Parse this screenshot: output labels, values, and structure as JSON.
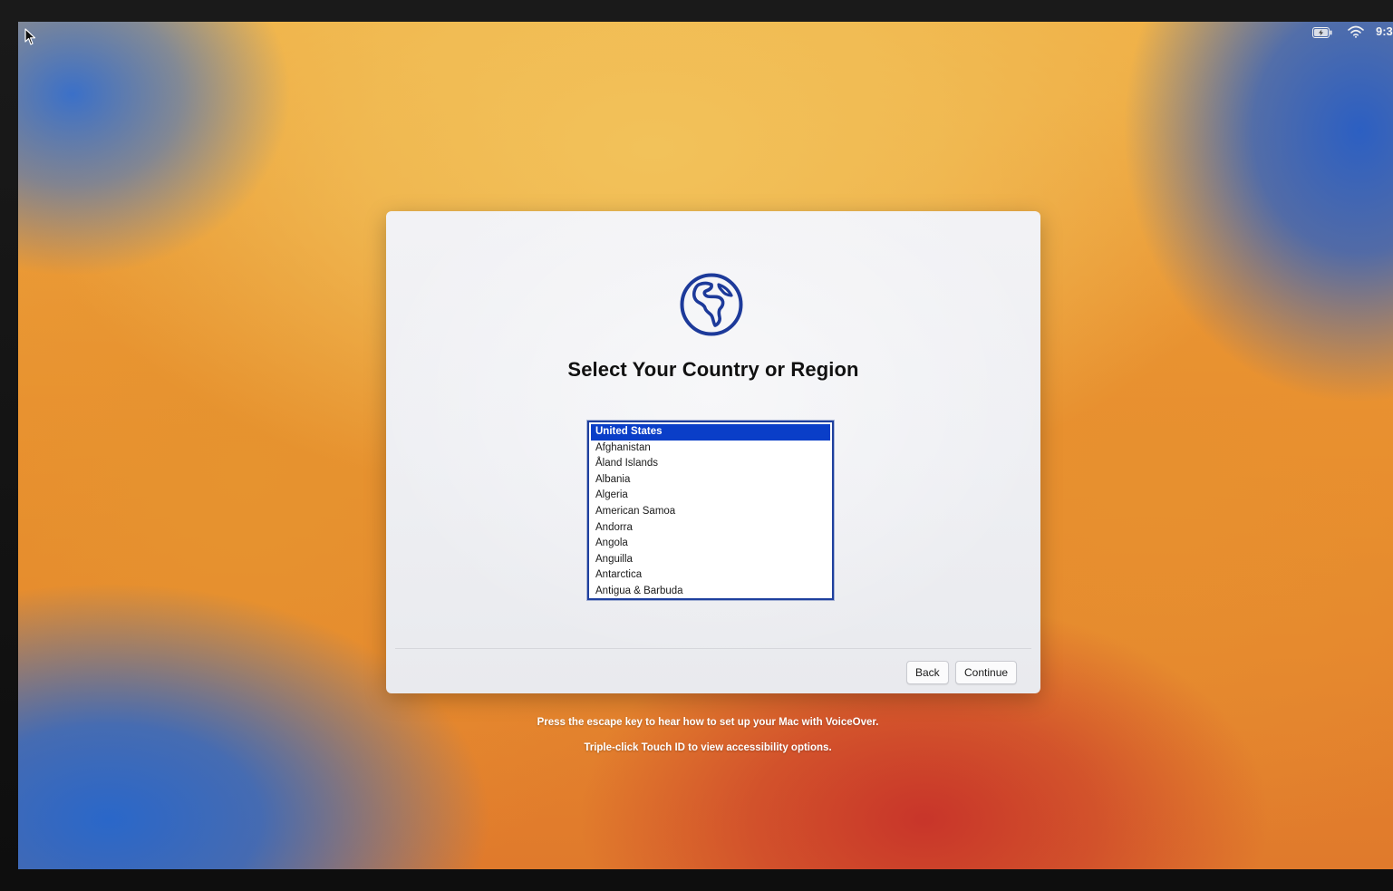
{
  "status_bar": {
    "clock": "9:3",
    "battery_icon": "battery-charging-icon",
    "wifi_icon": "wifi-icon"
  },
  "dialog": {
    "icon": "globe-icon",
    "title": "Select Your Country or Region",
    "countries": [
      "United States",
      "Afghanistan",
      "Åland Islands",
      "Albania",
      "Algeria",
      "American Samoa",
      "Andorra",
      "Angola",
      "Anguilla",
      "Antarctica",
      "Antigua & Barbuda"
    ],
    "selected": "United States",
    "back_label": "Back",
    "continue_label": "Continue"
  },
  "hints": {
    "voiceover": "Press the escape key to hear how to set up your Mac with VoiceOver.",
    "accessibility": "Triple-click Touch ID to view accessibility options."
  },
  "colors": {
    "selection": "#0a3ec8",
    "globe_stroke": "#1d3a9a",
    "list_border": "#1e3f9e"
  }
}
